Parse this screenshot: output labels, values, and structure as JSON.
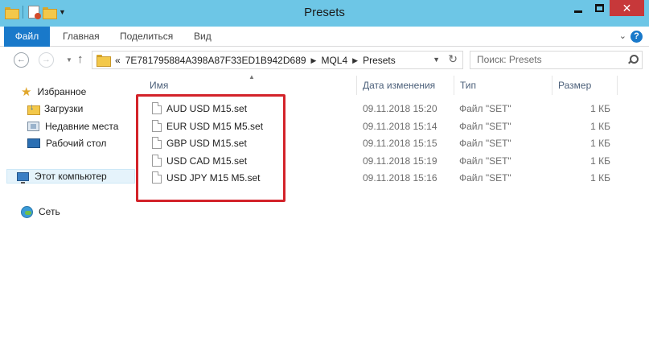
{
  "window": {
    "title": "Presets",
    "controls": {
      "minimize": "minimize",
      "maximize": "maximize",
      "close": "✕"
    }
  },
  "ribbon": {
    "tabs": [
      "Файл",
      "Главная",
      "Поделиться",
      "Вид"
    ],
    "help": "?"
  },
  "address": {
    "overflow": "«",
    "crumbs": [
      "7E781795884A398A87F33ED1B942D689",
      "MQL4",
      "Presets"
    ]
  },
  "search": {
    "placeholder": "Поиск: Presets"
  },
  "navigation": {
    "favorites_label": "Избранное",
    "favorites": [
      "Загрузки",
      "Недавние места",
      "Рабочий стол"
    ],
    "computer_label": "Этот компьютер",
    "network_label": "Сеть"
  },
  "columns": {
    "name": "Имя",
    "date": "Дата изменения",
    "type": "Тип",
    "size": "Размер"
  },
  "files": [
    {
      "name": "AUD USD M15.set",
      "date": "09.11.2018 15:20",
      "type": "Файл \"SET\"",
      "size": "1 КБ"
    },
    {
      "name": "EUR USD M15 M5.set",
      "date": "09.11.2018 15:14",
      "type": "Файл \"SET\"",
      "size": "1 КБ"
    },
    {
      "name": "GBP USD M15.set",
      "date": "09.11.2018 15:15",
      "type": "Файл \"SET\"",
      "size": "1 КБ"
    },
    {
      "name": "USD CAD M15.set",
      "date": "09.11.2018 15:19",
      "type": "Файл \"SET\"",
      "size": "1 КБ"
    },
    {
      "name": "USD JPY M15 M5.set",
      "date": "09.11.2018 15:16",
      "type": "Файл \"SET\"",
      "size": "1 КБ"
    }
  ],
  "colors": {
    "titlebar": "#6dc6e6",
    "file_tab": "#1979ca",
    "close_button": "#c7383a",
    "highlight": "#d3232a",
    "selection": "#e5f3fb"
  }
}
